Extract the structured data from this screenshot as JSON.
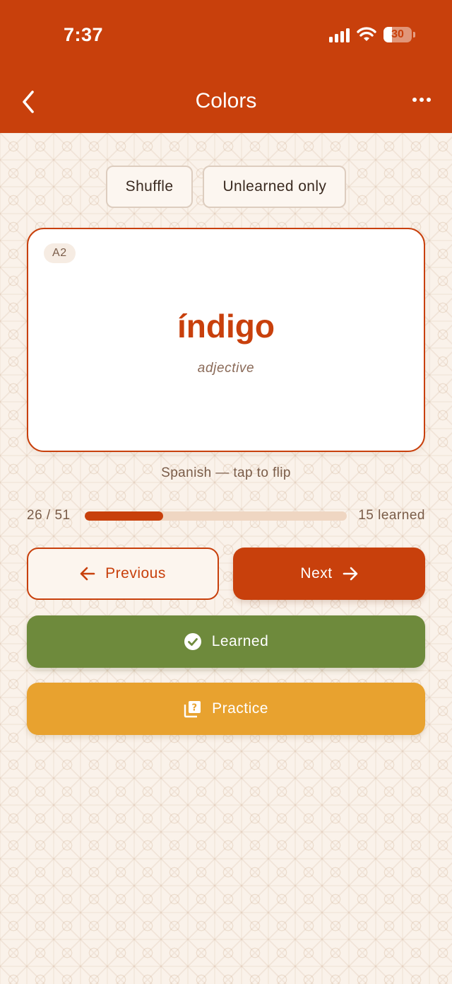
{
  "status_bar": {
    "time": "7:37",
    "battery_level": "30",
    "icons": [
      "signal-icon",
      "wifi-icon",
      "battery-icon"
    ]
  },
  "nav": {
    "title": "Colors",
    "back_icon": "chevron-left-icon",
    "more_icon": "more-horizontal-icon"
  },
  "filters": {
    "shuffle_label": "Shuffle",
    "unlearned_label": "Unlearned only"
  },
  "card": {
    "level": "A2",
    "word": "índigo",
    "part_of_speech": "adjective"
  },
  "hint": "Spanish — tap to flip",
  "progress": {
    "position_label": "26 / 51",
    "learned_label": "15 learned",
    "fraction": 0.3
  },
  "buttons": {
    "previous_label": "Previous",
    "next_label": "Next",
    "learned_label": "Learned",
    "practice_label": "Practice"
  },
  "colors": {
    "accent": "#c8400c",
    "learned": "#6e8a3c",
    "practice": "#e8a22f",
    "background": "#faf2ea"
  }
}
